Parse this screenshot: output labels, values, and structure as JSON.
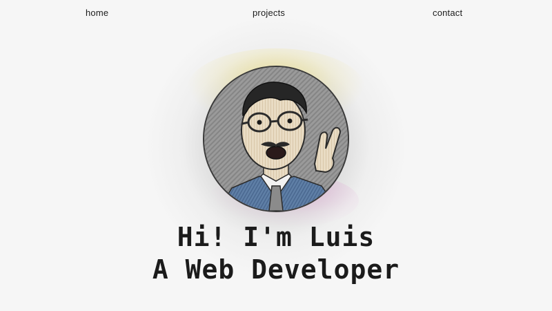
{
  "nav": {
    "home": "home",
    "projects": "projects",
    "contact": "contact"
  },
  "hero": {
    "line1": "Hi! I'm Luis",
    "line2": "A Web Developer",
    "avatar_icon": "person-portrait-illustration"
  },
  "colors": {
    "background": "#f6f6f6",
    "text": "#1b1b1b",
    "glow_yellow": "#f0dc5a",
    "glow_pink": "#dc78c8"
  }
}
